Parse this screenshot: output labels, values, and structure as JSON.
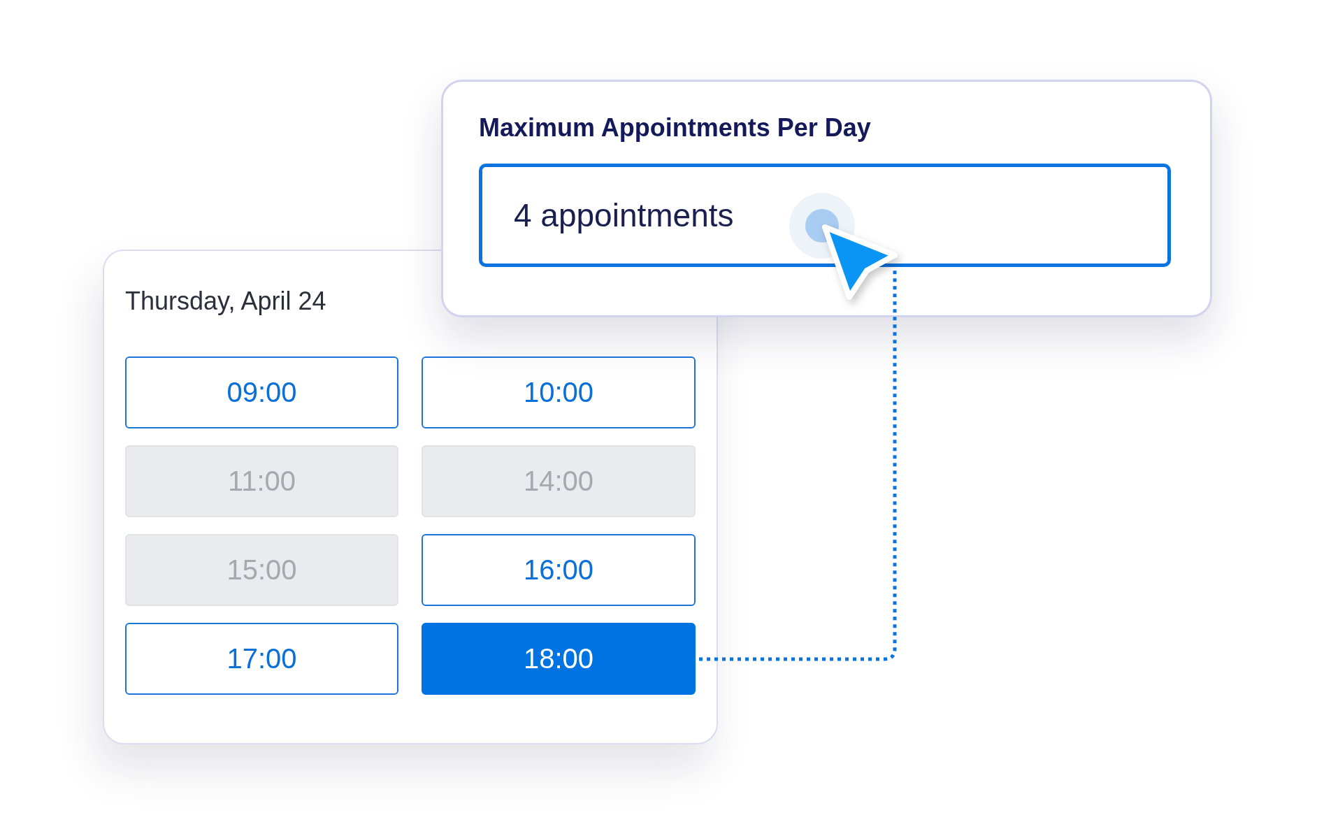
{
  "settings_card": {
    "title": "Maximum Appointments Per Day",
    "field": {
      "value": "4 appointments",
      "focused": true
    }
  },
  "schedule_card": {
    "date": "Thursday, April 24",
    "slots": [
      {
        "time": "09:00",
        "disabled": false,
        "selected": false
      },
      {
        "time": "10:00",
        "disabled": false,
        "selected": false
      },
      {
        "time": "11:00",
        "disabled": true,
        "selected": false
      },
      {
        "time": "14:00",
        "disabled": true,
        "selected": false
      },
      {
        "time": "15:00",
        "disabled": true,
        "selected": false
      },
      {
        "time": "16:00",
        "disabled": false,
        "selected": false
      },
      {
        "time": "17:00",
        "disabled": false,
        "selected": false
      },
      {
        "time": "18:00",
        "disabled": false,
        "selected": true
      }
    ]
  }
}
